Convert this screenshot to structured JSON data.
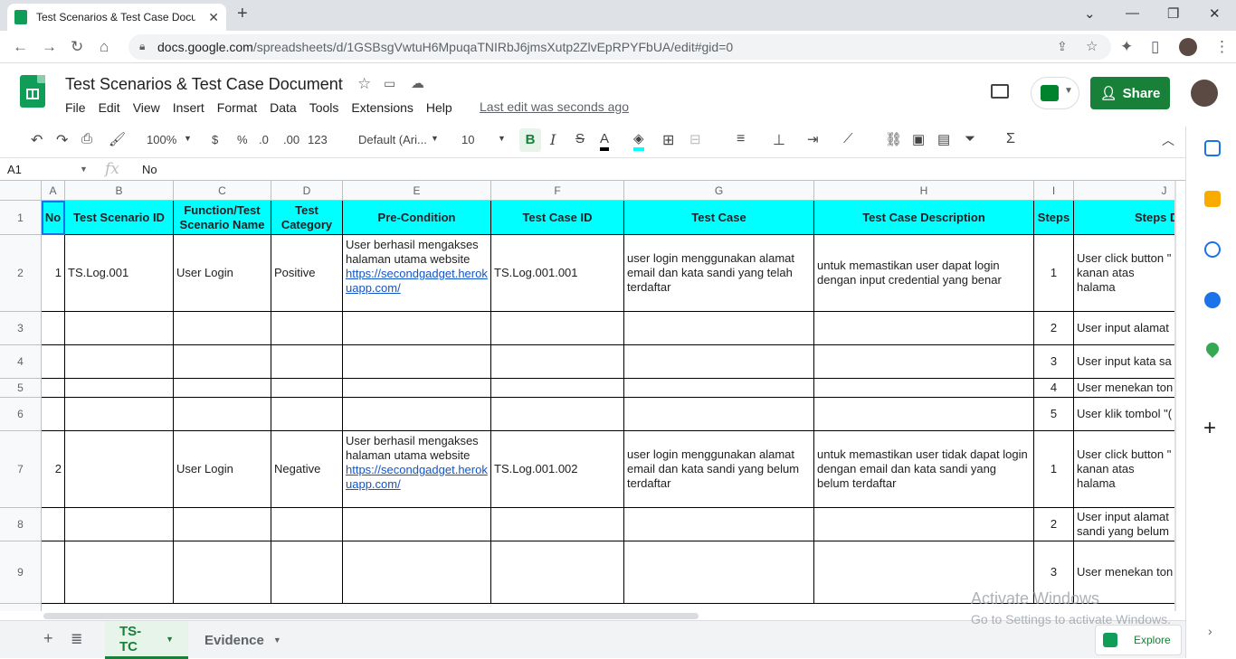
{
  "browser": {
    "tab_title": "Test Scenarios & Test Case Docur",
    "url_host": "docs.google.com",
    "url_path": "/spreadsheets/d/1GSBsgVwtuH6MpuqaTNIRbJ6jmsXutp2ZlvEpRPYFbUA/edit#gid=0"
  },
  "doc": {
    "title": "Test Scenarios & Test Case Document",
    "menus": [
      "File",
      "Edit",
      "View",
      "Insert",
      "Format",
      "Data",
      "Tools",
      "Extensions",
      "Help"
    ],
    "last_edit": "Last edit was seconds ago",
    "share_label": "Share"
  },
  "toolbar": {
    "zoom": "100%",
    "currency": "$",
    "percent": "%",
    "dec_minus": ".0",
    "dec_plus": ".00",
    "more_formats": "123",
    "font": "Default (Ari...",
    "font_size": "10",
    "bold": "B",
    "italic": "I",
    "strike": "S",
    "text_color": "A"
  },
  "formula_bar": {
    "cell_ref": "A1",
    "fx": "fx",
    "value": "No"
  },
  "columns": [
    "A",
    "B",
    "C",
    "D",
    "E",
    "F",
    "G",
    "H",
    "I",
    "J"
  ],
  "rows": [
    "1",
    "2",
    "3",
    "4",
    "5",
    "6",
    "7",
    "8",
    "9"
  ],
  "header": {
    "no": "No",
    "scenario_id": "Test Scenario ID",
    "function_l1": "Function/Test",
    "function_l2": "Scenario Name",
    "category_l1": "Test",
    "category_l2": "Category",
    "precondition": "Pre-Condition",
    "case_id": "Test Case ID",
    "test_case": "Test Case",
    "description": "Test Case Description",
    "steps": "Steps",
    "steps_desc": "Steps De"
  },
  "row2": {
    "no": "1",
    "scenario_id": "TS.Log.001",
    "function": "User Login",
    "category": "Positive",
    "pre_text": "User berhasil mengakses halaman utama website",
    "pre_link": "https://secondgadget.herokuapp.com/",
    "case_id": "TS.Log.001.001",
    "test_case": "user login menggunakan alamat email dan kata sandi yang telah terdaftar",
    "description": "untuk memastikan user dapat login dengan input credential yang benar",
    "step": "1",
    "step_desc": "User click button \" kanan atas halama"
  },
  "row3": {
    "step": "2",
    "step_desc": "User input alamat"
  },
  "row4": {
    "step": "3",
    "step_desc": "User input kata sa"
  },
  "row5": {
    "step": "4",
    "step_desc": "User menekan ton"
  },
  "row6": {
    "step": "5",
    "step_desc": "User klik tombol \"("
  },
  "row7": {
    "no": "2",
    "function": "User Login",
    "category": "Negative",
    "pre_text": "User berhasil mengakses halaman utama website",
    "pre_link": "https://secondgadget.herokuapp.com/",
    "case_id": "TS.Log.001.002",
    "test_case": "user login menggunakan alamat email dan kata sandi yang belum terdaftar",
    "description": "untuk memastikan user tidak dapat login dengan email dan kata sandi yang belum terdaftar",
    "step": "1",
    "step_desc": "User click button \" kanan atas halama"
  },
  "row8": {
    "step": "2",
    "step_desc": "User input alamat sandi yang belum"
  },
  "row9": {
    "step": "3",
    "step_desc": "User menekan ton"
  },
  "sheets": {
    "active": "TS-TC",
    "other": "Evidence",
    "explore": "Explore"
  },
  "watermark": {
    "line1": "Activate Windows",
    "line2": "Go to Settings to activate Windows."
  },
  "colors": {
    "header_fill": "#00ffff",
    "share_green": "#188038",
    "link": "#1155cc"
  }
}
